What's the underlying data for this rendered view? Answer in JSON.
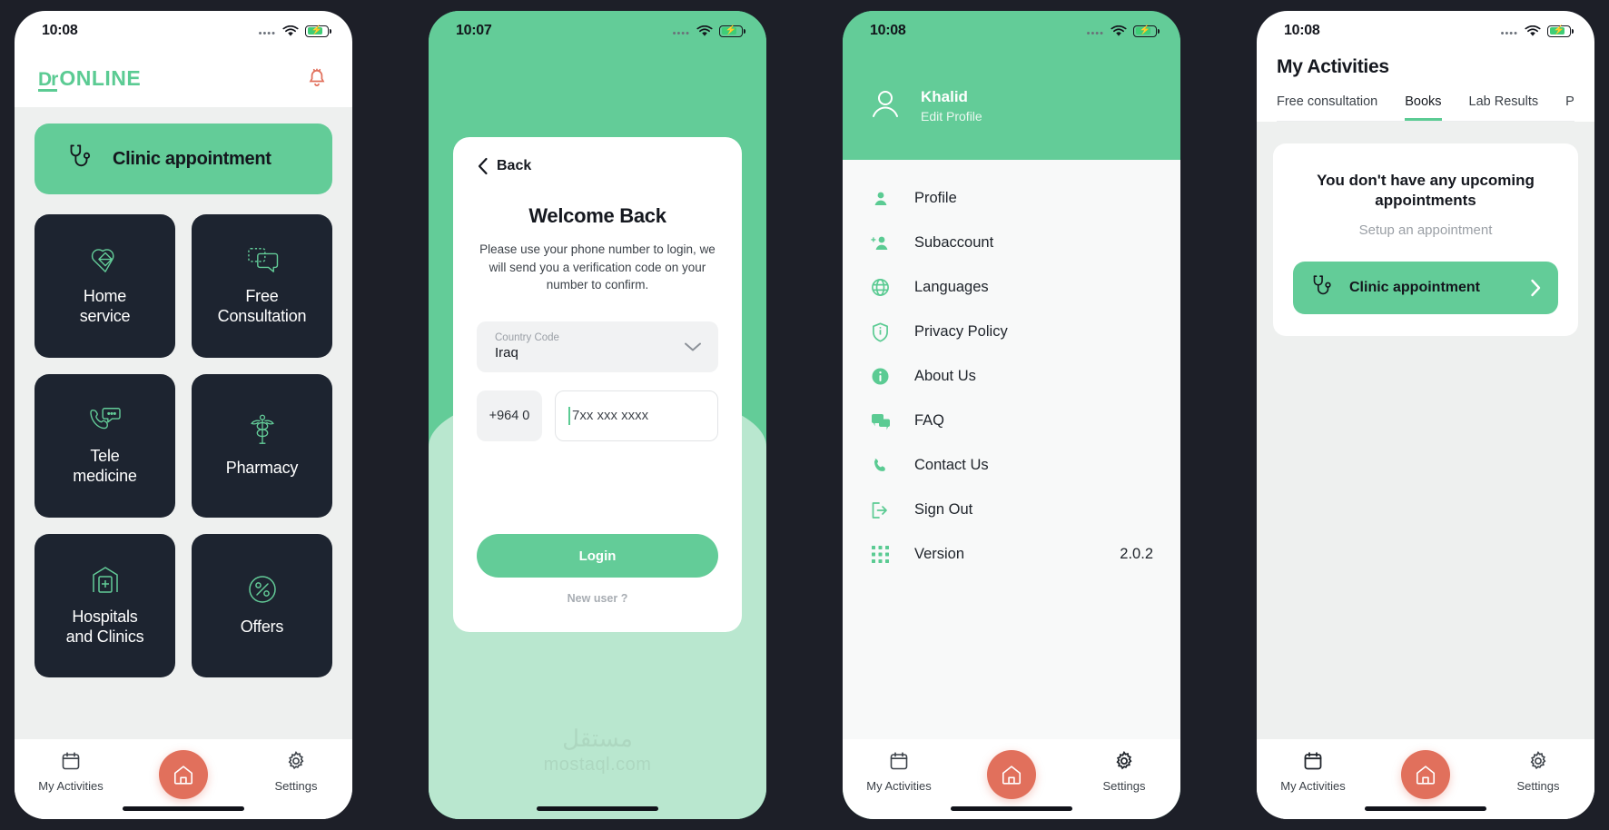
{
  "screens": {
    "home": {
      "status": {
        "time": "10:08"
      },
      "logo": {
        "dr": "Dr",
        "online": "ONLINE"
      },
      "clinic_button": "Clinic appointment",
      "tiles": [
        {
          "label": "Home\nservice",
          "icon": "heart-hands-icon"
        },
        {
          "label": "Free\nConsultation",
          "icon": "chat-bubbles-icon"
        },
        {
          "label": "Tele\nmedicine",
          "icon": "phone-chat-icon"
        },
        {
          "label": "Pharmacy",
          "icon": "caduceus-icon"
        },
        {
          "label": "Hospitals\nand Clinics",
          "icon": "hospital-icon"
        },
        {
          "label": "Offers",
          "icon": "percent-icon"
        }
      ],
      "nav": {
        "left": "My Activities",
        "center": "home-fab",
        "right": "Settings"
      }
    },
    "login": {
      "status": {
        "time": "10:07"
      },
      "back": "Back",
      "title": "Welcome Back",
      "subtitle": "Please use your phone number to login, we will send you a verification code on your number to confirm.",
      "country_code": {
        "label": "Country Code",
        "value": "Iraq"
      },
      "phone": {
        "prefix": "+964 0",
        "placeholder": "7xx xxx xxxx"
      },
      "login_button": "Login",
      "new_user": "New user ?",
      "watermark": {
        "arabic": "مستقل",
        "latin": "mostaql.com"
      }
    },
    "settings": {
      "status": {
        "time": "10:08"
      },
      "user": {
        "name": "Khalid",
        "edit": "Edit Profile"
      },
      "menu": [
        {
          "label": "Profile",
          "icon": "person-icon",
          "value": ""
        },
        {
          "label": "Subaccount",
          "icon": "person-add-icon",
          "value": ""
        },
        {
          "label": "Languages",
          "icon": "globe-icon",
          "value": ""
        },
        {
          "label": "Privacy Policy",
          "icon": "shield-info-icon",
          "value": ""
        },
        {
          "label": "About Us",
          "icon": "info-icon",
          "value": ""
        },
        {
          "label": "FAQ",
          "icon": "chat-icon",
          "value": ""
        },
        {
          "label": "Contact Us",
          "icon": "phone-icon",
          "value": ""
        },
        {
          "label": "Sign Out",
          "icon": "sign-out-icon",
          "value": ""
        },
        {
          "label": "Version",
          "icon": "grid-dots-icon",
          "value": "2.0.2"
        }
      ],
      "nav": {
        "left": "My Activities",
        "center": "home-fab",
        "right": "Settings"
      }
    },
    "activities": {
      "status": {
        "time": "10:08"
      },
      "title": "My Activities",
      "tabs": [
        {
          "label": "Free consultation",
          "active": false
        },
        {
          "label": "Books",
          "active": true
        },
        {
          "label": "Lab Results",
          "active": false
        },
        {
          "label": "Prescri",
          "active": false
        }
      ],
      "empty": {
        "title": "You don't have any upcoming appointments",
        "subtitle": "Setup an appointment",
        "button": "Clinic appointment"
      },
      "nav": {
        "left": "My Activities",
        "center": "home-fab",
        "right": "Settings"
      }
    }
  },
  "colors": {
    "green": "#63cc98",
    "green_light": "#b9e7cf",
    "dark": "#1d2430",
    "coral": "#e1705c",
    "bg": "#eef0ef"
  }
}
